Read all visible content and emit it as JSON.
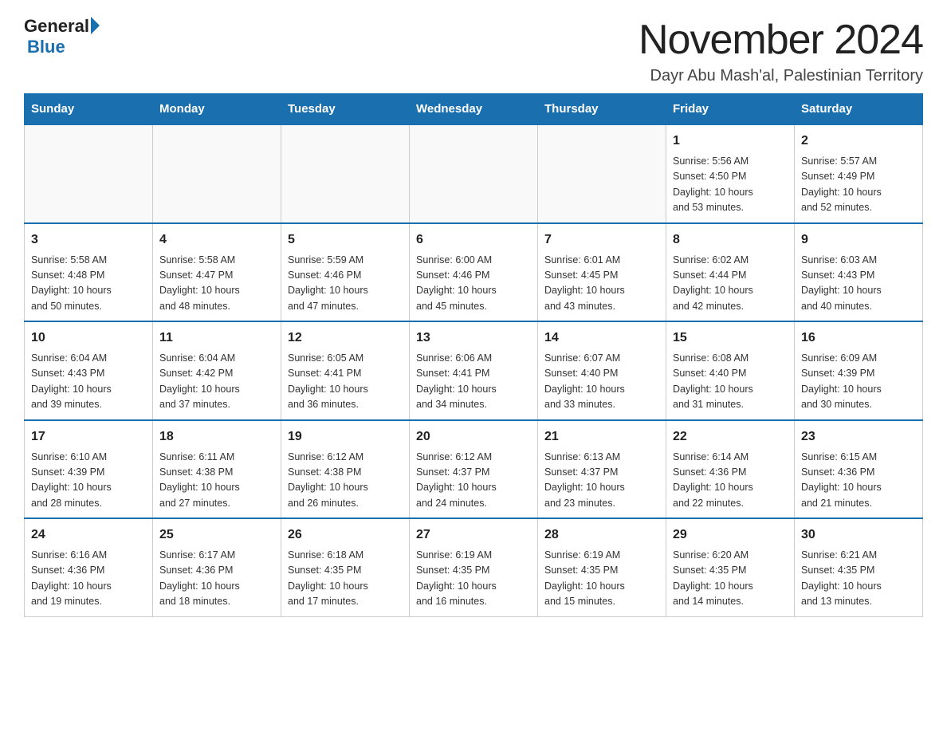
{
  "logo": {
    "general": "General",
    "blue": "Blue",
    "triangle_alt": "logo triangle"
  },
  "title": "November 2024",
  "subtitle": "Dayr Abu Mash'al, Palestinian Territory",
  "days_of_week": [
    "Sunday",
    "Monday",
    "Tuesday",
    "Wednesday",
    "Thursday",
    "Friday",
    "Saturday"
  ],
  "weeks": [
    [
      {
        "day": "",
        "info": ""
      },
      {
        "day": "",
        "info": ""
      },
      {
        "day": "",
        "info": ""
      },
      {
        "day": "",
        "info": ""
      },
      {
        "day": "",
        "info": ""
      },
      {
        "day": "1",
        "info": "Sunrise: 5:56 AM\nSunset: 4:50 PM\nDaylight: 10 hours\nand 53 minutes."
      },
      {
        "day": "2",
        "info": "Sunrise: 5:57 AM\nSunset: 4:49 PM\nDaylight: 10 hours\nand 52 minutes."
      }
    ],
    [
      {
        "day": "3",
        "info": "Sunrise: 5:58 AM\nSunset: 4:48 PM\nDaylight: 10 hours\nand 50 minutes."
      },
      {
        "day": "4",
        "info": "Sunrise: 5:58 AM\nSunset: 4:47 PM\nDaylight: 10 hours\nand 48 minutes."
      },
      {
        "day": "5",
        "info": "Sunrise: 5:59 AM\nSunset: 4:46 PM\nDaylight: 10 hours\nand 47 minutes."
      },
      {
        "day": "6",
        "info": "Sunrise: 6:00 AM\nSunset: 4:46 PM\nDaylight: 10 hours\nand 45 minutes."
      },
      {
        "day": "7",
        "info": "Sunrise: 6:01 AM\nSunset: 4:45 PM\nDaylight: 10 hours\nand 43 minutes."
      },
      {
        "day": "8",
        "info": "Sunrise: 6:02 AM\nSunset: 4:44 PM\nDaylight: 10 hours\nand 42 minutes."
      },
      {
        "day": "9",
        "info": "Sunrise: 6:03 AM\nSunset: 4:43 PM\nDaylight: 10 hours\nand 40 minutes."
      }
    ],
    [
      {
        "day": "10",
        "info": "Sunrise: 6:04 AM\nSunset: 4:43 PM\nDaylight: 10 hours\nand 39 minutes."
      },
      {
        "day": "11",
        "info": "Sunrise: 6:04 AM\nSunset: 4:42 PM\nDaylight: 10 hours\nand 37 minutes."
      },
      {
        "day": "12",
        "info": "Sunrise: 6:05 AM\nSunset: 4:41 PM\nDaylight: 10 hours\nand 36 minutes."
      },
      {
        "day": "13",
        "info": "Sunrise: 6:06 AM\nSunset: 4:41 PM\nDaylight: 10 hours\nand 34 minutes."
      },
      {
        "day": "14",
        "info": "Sunrise: 6:07 AM\nSunset: 4:40 PM\nDaylight: 10 hours\nand 33 minutes."
      },
      {
        "day": "15",
        "info": "Sunrise: 6:08 AM\nSunset: 4:40 PM\nDaylight: 10 hours\nand 31 minutes."
      },
      {
        "day": "16",
        "info": "Sunrise: 6:09 AM\nSunset: 4:39 PM\nDaylight: 10 hours\nand 30 minutes."
      }
    ],
    [
      {
        "day": "17",
        "info": "Sunrise: 6:10 AM\nSunset: 4:39 PM\nDaylight: 10 hours\nand 28 minutes."
      },
      {
        "day": "18",
        "info": "Sunrise: 6:11 AM\nSunset: 4:38 PM\nDaylight: 10 hours\nand 27 minutes."
      },
      {
        "day": "19",
        "info": "Sunrise: 6:12 AM\nSunset: 4:38 PM\nDaylight: 10 hours\nand 26 minutes."
      },
      {
        "day": "20",
        "info": "Sunrise: 6:12 AM\nSunset: 4:37 PM\nDaylight: 10 hours\nand 24 minutes."
      },
      {
        "day": "21",
        "info": "Sunrise: 6:13 AM\nSunset: 4:37 PM\nDaylight: 10 hours\nand 23 minutes."
      },
      {
        "day": "22",
        "info": "Sunrise: 6:14 AM\nSunset: 4:36 PM\nDaylight: 10 hours\nand 22 minutes."
      },
      {
        "day": "23",
        "info": "Sunrise: 6:15 AM\nSunset: 4:36 PM\nDaylight: 10 hours\nand 21 minutes."
      }
    ],
    [
      {
        "day": "24",
        "info": "Sunrise: 6:16 AM\nSunset: 4:36 PM\nDaylight: 10 hours\nand 19 minutes."
      },
      {
        "day": "25",
        "info": "Sunrise: 6:17 AM\nSunset: 4:36 PM\nDaylight: 10 hours\nand 18 minutes."
      },
      {
        "day": "26",
        "info": "Sunrise: 6:18 AM\nSunset: 4:35 PM\nDaylight: 10 hours\nand 17 minutes."
      },
      {
        "day": "27",
        "info": "Sunrise: 6:19 AM\nSunset: 4:35 PM\nDaylight: 10 hours\nand 16 minutes."
      },
      {
        "day": "28",
        "info": "Sunrise: 6:19 AM\nSunset: 4:35 PM\nDaylight: 10 hours\nand 15 minutes."
      },
      {
        "day": "29",
        "info": "Sunrise: 6:20 AM\nSunset: 4:35 PM\nDaylight: 10 hours\nand 14 minutes."
      },
      {
        "day": "30",
        "info": "Sunrise: 6:21 AM\nSunset: 4:35 PM\nDaylight: 10 hours\nand 13 minutes."
      }
    ]
  ]
}
